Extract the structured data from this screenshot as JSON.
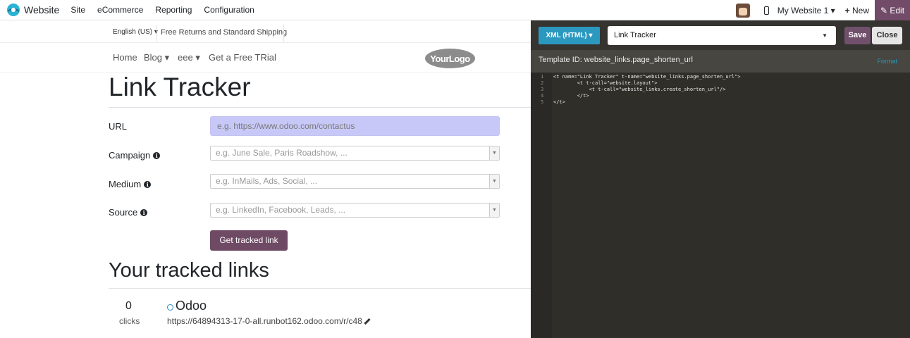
{
  "topbar": {
    "brand": "Website",
    "menu": [
      "Site",
      "eCommerce",
      "Reporting",
      "Configuration"
    ],
    "website_switch": "My Website 1",
    "new_label": "New",
    "edit_label": "Edit",
    "icons": [
      "odoo-logo-icon",
      "user-avatar",
      "mobile-preview-icon",
      "plus-icon",
      "pencil-icon"
    ],
    "colors": {
      "edit_bg": "#714b67"
    }
  },
  "site": {
    "language": "English (US)",
    "shipping_note": "Free Returns and Standard Shipping",
    "nav": [
      "Home",
      "Blog",
      "eee",
      "Get a Free TRial"
    ],
    "logo_text": "YourLogo",
    "title": "Link Tracker",
    "form": {
      "url_label": "URL",
      "url_placeholder": "e.g. https://www.odoo.com/contactus",
      "campaign_label": "Campaign",
      "campaign_placeholder": "e.g. June Sale, Paris Roadshow, ...",
      "medium_label": "Medium",
      "medium_placeholder": "e.g. InMails, Ads, Social, ...",
      "source_label": "Source",
      "source_placeholder": "e.g. LinkedIn, Facebook, Leads, ...",
      "submit": "Get tracked link"
    },
    "tracked_title": "Your tracked links",
    "links": [
      {
        "clicks": "0",
        "clicks_label": "clicks",
        "title": "Odoo",
        "url": "https://64894313-17-0-all.runbot162.odoo.com/r/c48"
      }
    ]
  },
  "editor": {
    "language": "XML (HTML)",
    "template": "Link Tracker",
    "save": "Save",
    "close": "Close",
    "template_id": "Template ID: website_links.page_shorten_url",
    "format": "Format",
    "code": [
      {
        "n": "1",
        "text": "<t name=\"Link Tracker\" t-name=\"website_links.page_shorten_url\">"
      },
      {
        "n": "2",
        "text": "        <t t-call=\"website.layout\">"
      },
      {
        "n": "3",
        "text": "            <t t-call=\"website_links.create_shorten_url\"/>"
      },
      {
        "n": "4",
        "text": "        </t>"
      },
      {
        "n": "5",
        "text": "</t>"
      }
    ],
    "colors": {
      "panel_bg": "#2f2e28",
      "accent": "#2b98bf"
    }
  }
}
